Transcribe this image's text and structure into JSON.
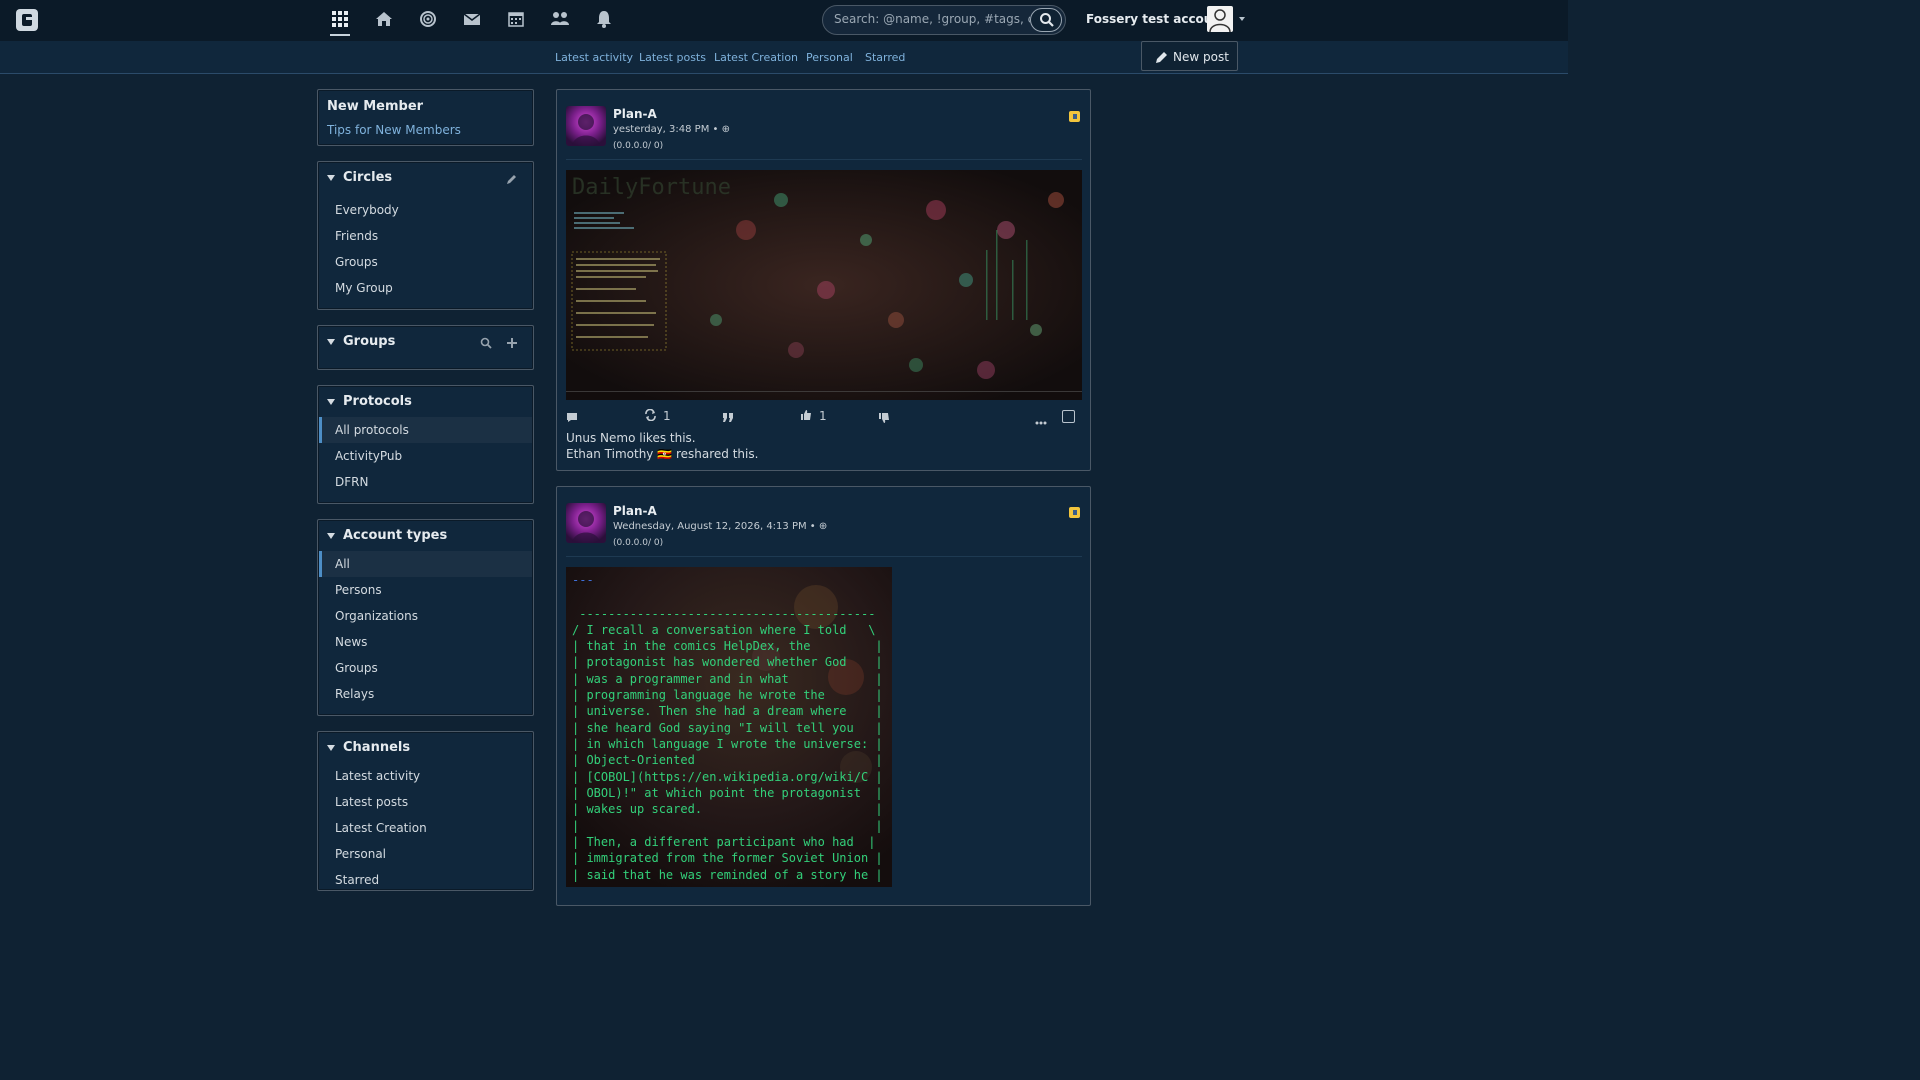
{
  "nav": {
    "icons": [
      "apps-icon",
      "home-icon",
      "network-icon",
      "mail-icon",
      "calendar-icon",
      "contacts-icon",
      "bell-icon"
    ],
    "search_placeholder": "Search: @name, !group, #tags, content",
    "account_name": "Fossery test account"
  },
  "subnav": {
    "links": [
      "Latest activity",
      "Latest posts",
      "Latest Creation",
      "Personal",
      "Starred"
    ],
    "new_post": "New post"
  },
  "sidebar": {
    "new_member": {
      "title": "New Member",
      "link": "Tips for New Members"
    },
    "circles": {
      "title": "Circles",
      "items": [
        "Everybody",
        "Friends",
        "Groups",
        "My Group"
      ]
    },
    "groups": {
      "title": "Groups"
    },
    "protocols": {
      "title": "Protocols",
      "items": [
        "All protocols",
        "ActivityPub",
        "DFRN"
      ],
      "selected": 0
    },
    "account_types": {
      "title": "Account types",
      "items": [
        "All",
        "Persons",
        "Organizations",
        "News",
        "Groups",
        "Relays"
      ],
      "selected": 0
    },
    "channels": {
      "title": "Channels",
      "items": [
        "Latest activity",
        "Latest posts",
        "Latest Creation",
        "Personal",
        "Starred"
      ]
    }
  },
  "posts": [
    {
      "author": "Plan-A",
      "time": "yesterday, 3:48 PM",
      "votes": "(0.0.0.0/ 0)",
      "reshare_count": "1",
      "like_count": "1",
      "likes": "Unus Nemo likes this.",
      "reshares": "Ethan Timothy 🇺🇬 reshared this."
    },
    {
      "author": "Plan-A",
      "time": "Wednesday, August 12, 2026, 4:13 PM",
      "votes": "(0.0.0.0/ 0)",
      "code_lines": [
        "---",
        "",
        " -----------------------------------------",
        "/ I recall a conversation where I told   \\",
        "| that in the comics HelpDex, the         |",
        "| protagonist has wondered whether God    |",
        "| was a programmer and in what            |",
        "| programming language he wrote the       |",
        "| universe. Then she had a dream where    |",
        "| she heard God saying \"I will tell you   |",
        "| in which language I wrote the universe: |",
        "| Object-Oriented                         |",
        "| [COBOL](https://en.wikipedia.org/wiki/C |",
        "| OBOL)!\" at which point the protagonist  |",
        "| wakes up scared.                        |",
        "|                                         |",
        "| Then, a different participant who had  |",
        "| immigrated from the former Soviet Union |",
        "| said that he was reminded of a story he |"
      ]
    }
  ]
}
